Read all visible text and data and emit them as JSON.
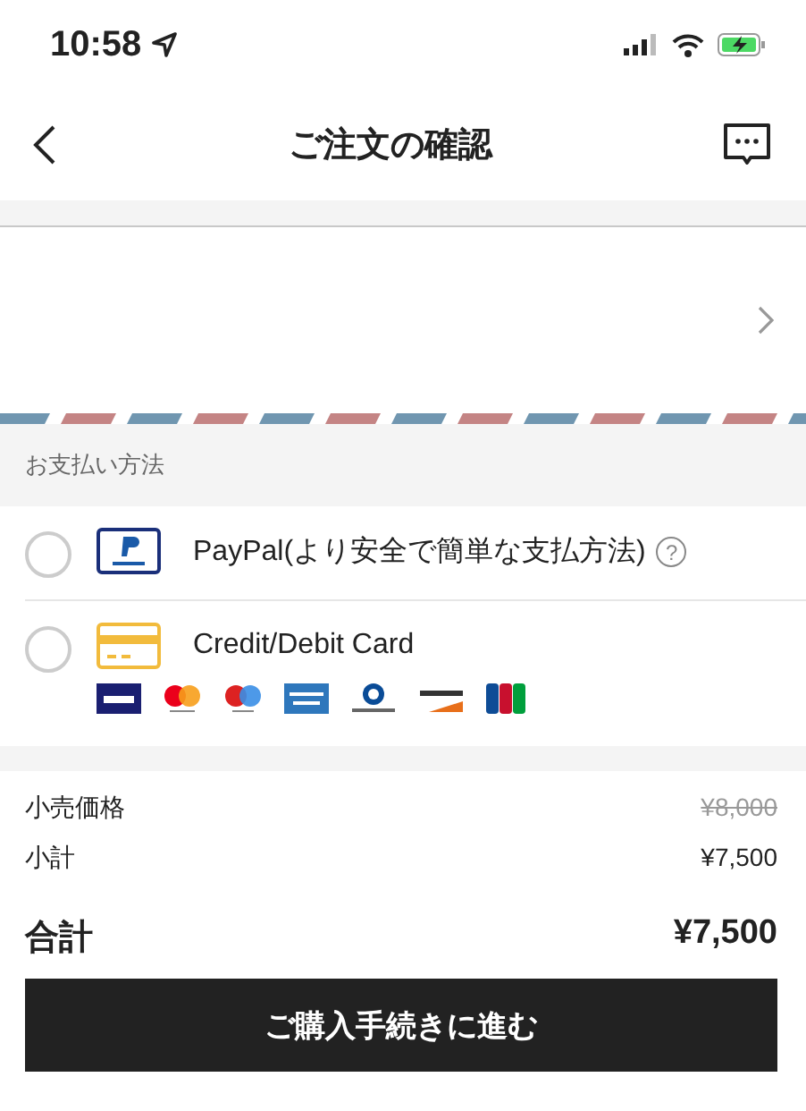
{
  "status_bar": {
    "time": "10:58"
  },
  "nav": {
    "title": "ご注文の確認"
  },
  "payment": {
    "heading": "お支払い方法",
    "methods": [
      {
        "kind": "paypal",
        "label": "PayPal(より安全で簡単な支払方法)",
        "help": "?",
        "selected": false
      },
      {
        "kind": "card",
        "label": "Credit/Debit Card",
        "selected": false
      }
    ]
  },
  "prices": [
    {
      "label": "小売価格",
      "value": "¥8,000",
      "struck": true
    },
    {
      "label": "小計",
      "value": "¥7,500",
      "struck": false
    }
  ],
  "total": {
    "label": "合計",
    "value": "¥7,500"
  },
  "checkout_button": "ご購入手続きに進む"
}
